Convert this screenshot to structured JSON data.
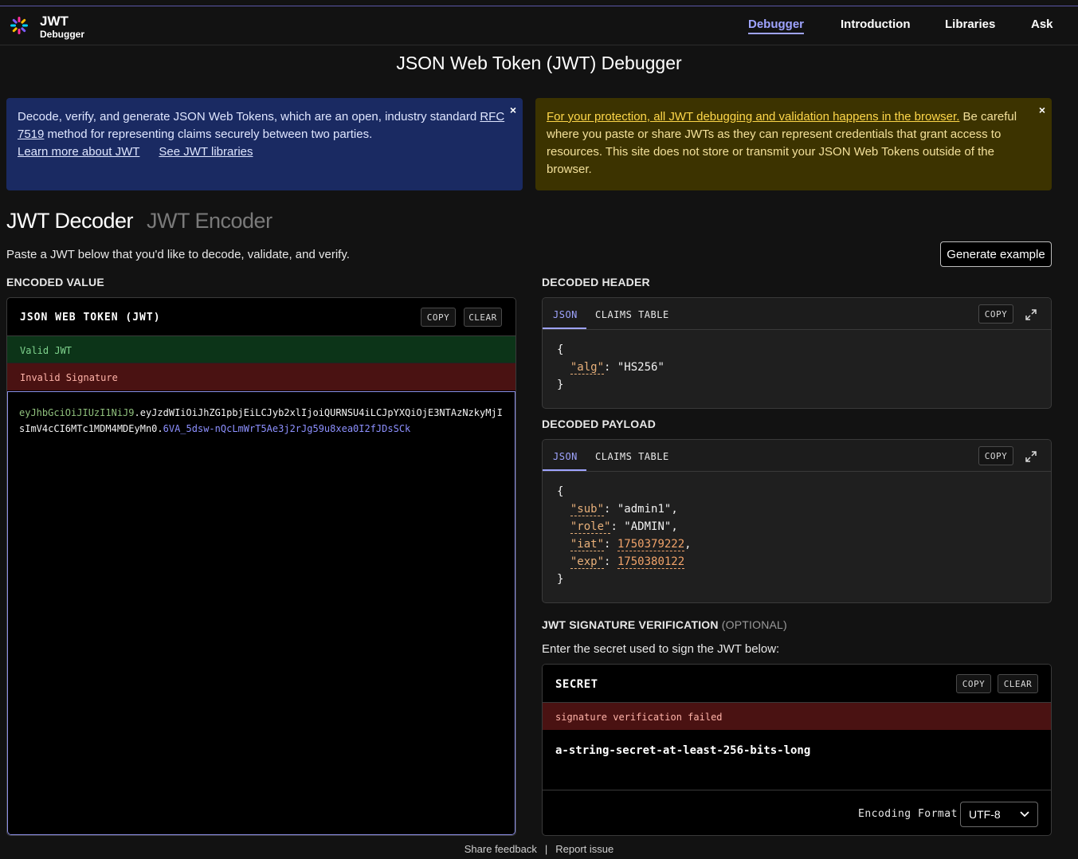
{
  "header": {
    "brand_title": "JWT",
    "brand_subtitle": "Debugger",
    "nav": [
      {
        "label": "Debugger",
        "active": true
      },
      {
        "label": "Introduction",
        "active": false
      },
      {
        "label": "Libraries",
        "active": false
      },
      {
        "label": "Ask",
        "active": false
      }
    ]
  },
  "page_title": "JSON Web Token (JWT) Debugger",
  "info_banner": {
    "text_1": "Decode, verify, and generate JSON Web Tokens, which are an open, industry standard ",
    "rfc_link": "RFC 7519",
    "text_2": " method for representing claims securely between two parties.",
    "link_learn": "Learn more about JWT",
    "link_libraries": "See JWT libraries",
    "close": "×"
  },
  "warning_banner": {
    "link_text": "For your protection, all JWT debugging and validation happens in the browser.",
    "text": " Be careful where you paste or share JWTs as they can represent credentials that grant access to resources. This site does not store or transmit your JSON Web Tokens outside of the browser.",
    "close": "×"
  },
  "tabs": {
    "decoder": "JWT Decoder",
    "encoder": "JWT Encoder"
  },
  "intro": "Paste a JWT below that you'd like to decode, validate, and verify.",
  "generate_button": "Generate example",
  "encoded": {
    "section_label": "ENCODED VALUE",
    "panel_title": "JSON WEB TOKEN (JWT)",
    "copy": "COPY",
    "clear": "CLEAR",
    "valid_status": "Valid JWT",
    "invalid_status": "Invalid Signature",
    "token_header": "eyJhbGciOiJIUzI1NiJ9",
    "token_dot1": ".",
    "token_payload": "eyJzdWIiOiJhZG1pbjEiLCJyb2xlIjoiQURNSU4iLCJpYXQiOjE3NTAzNzkyMjIsImV4cCI6MTc1MDM4MDEyMn0",
    "token_dot2": ".",
    "token_signature": "6VA_5dsw-nQcLmWrT5Ae3j2rJg59u8xea0I2fJDsSCk"
  },
  "decoded_header": {
    "section_label": "DECODED HEADER",
    "tab_json": "JSON",
    "tab_claims": "CLAIMS TABLE",
    "copy": "COPY",
    "open_brace": "{",
    "close_brace": "}",
    "alg_key": "\"alg\"",
    "alg_value": "\"HS256\""
  },
  "decoded_payload": {
    "section_label": "DECODED PAYLOAD",
    "tab_json": "JSON",
    "tab_claims": "CLAIMS TABLE",
    "copy": "COPY",
    "open_brace": "{",
    "close_brace": "}",
    "sub_key": "\"sub\"",
    "sub_value": "\"admin1\"",
    "role_key": "\"role\"",
    "role_value": "\"ADMIN\"",
    "iat_key": "\"iat\"",
    "iat_value": "1750379222",
    "exp_key": "\"exp\"",
    "exp_value": "1750380122"
  },
  "signature": {
    "section_label": "JWT SIGNATURE VERIFICATION",
    "section_optional": "(OPTIONAL)",
    "instructions": "Enter the secret used to sign the JWT below:",
    "panel_title": "SECRET",
    "copy": "COPY",
    "clear": "CLEAR",
    "status": "signature verification failed",
    "secret_value": "a-string-secret-at-least-256-bits-long",
    "encoding_label": "Encoding Format",
    "encoding_value": "UTF-8"
  },
  "footer": {
    "feedback": "Share feedback",
    "separator": "|",
    "report": "Report issue"
  },
  "colors": {
    "accent": "#9fa4ff",
    "valid_bg": "#0c3418",
    "invalid_bg": "#4a1212",
    "info_bg": "#1a2a62",
    "warning_bg": "#3c3300"
  }
}
